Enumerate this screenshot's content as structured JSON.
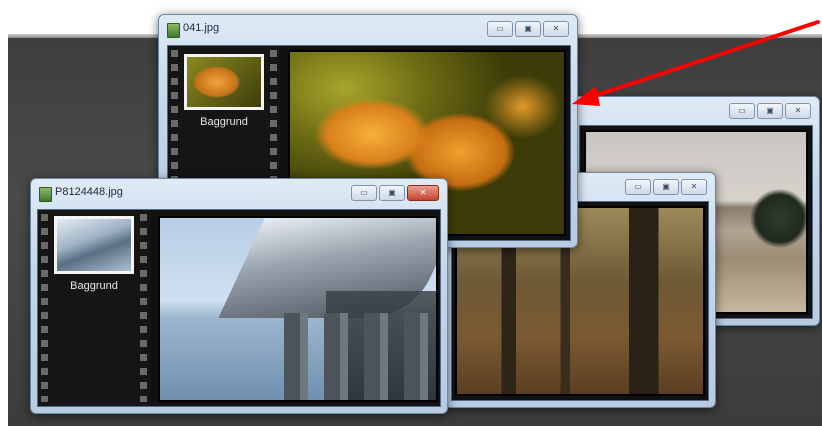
{
  "windows": {
    "leaves": {
      "title": "041.jpg",
      "thumbnail_label": "Baggrund",
      "controls": [
        "minimize",
        "maximize",
        "close"
      ]
    },
    "bridge": {
      "title": "P8124448.jpg",
      "thumbnail_label": "Baggrund",
      "controls": [
        "minimize",
        "maximize",
        "close"
      ]
    },
    "forest": {
      "controls": [
        "minimize",
        "maximize",
        "close"
      ]
    },
    "lake": {
      "controls": [
        "minimize",
        "maximize",
        "close"
      ]
    }
  },
  "icons": {
    "minimize": "▭",
    "maximize": "▣",
    "close": "✕"
  },
  "annotation": {
    "arrow_color": "#ff0000"
  }
}
